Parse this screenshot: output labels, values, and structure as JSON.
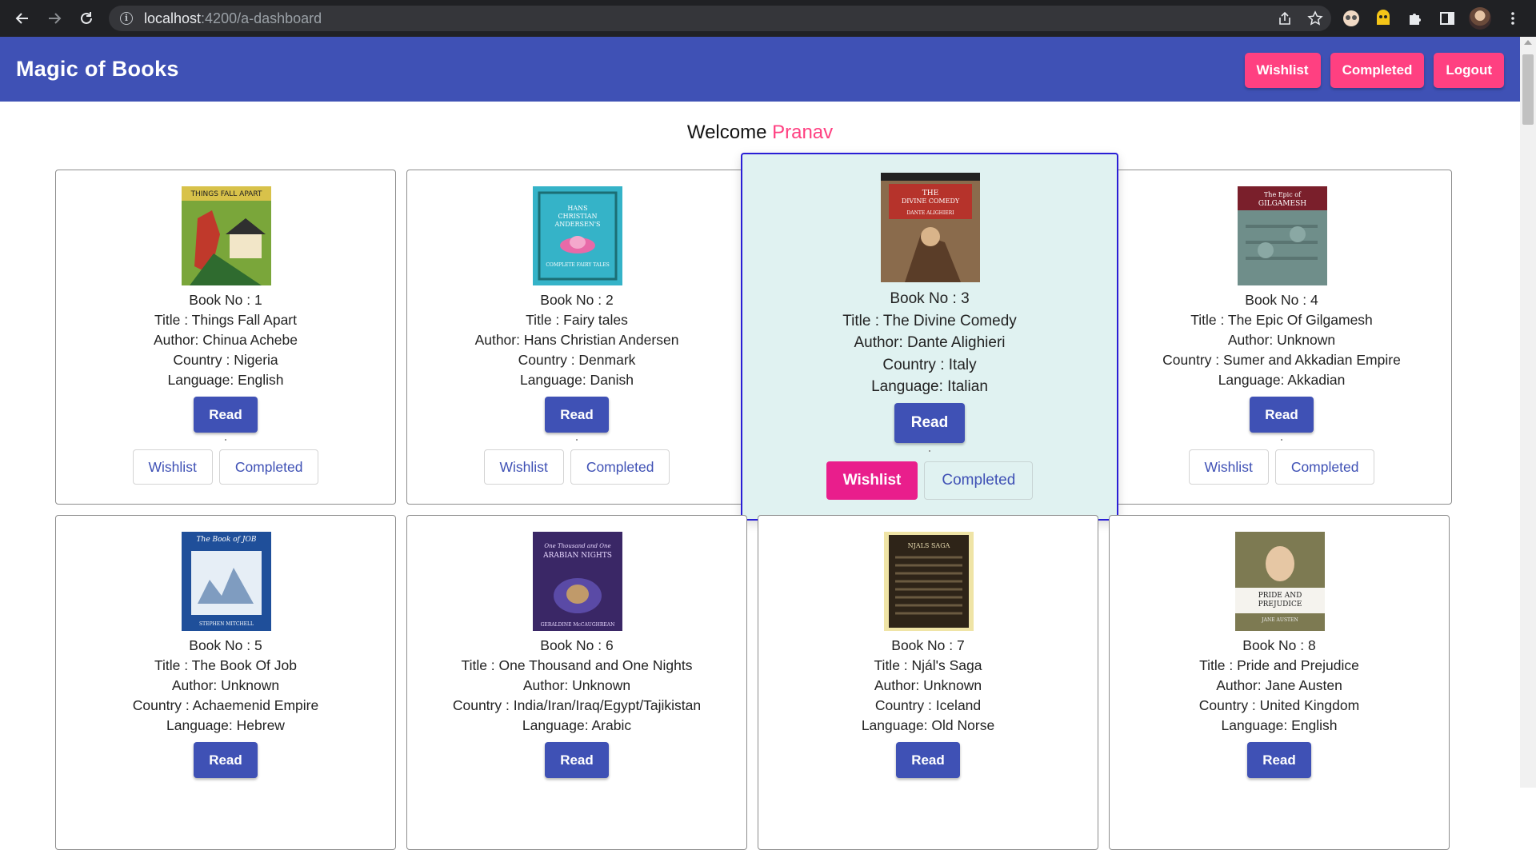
{
  "browser": {
    "url_host": "localhost",
    "url_path": ":4200/a-dashboard"
  },
  "toolbar": {
    "title": "Magic of Books",
    "wishlist_label": "Wishlist",
    "completed_label": "Completed",
    "logout_label": "Logout",
    "accent_color": "#3f51b5",
    "button_color": "#ff4081"
  },
  "welcome": {
    "prefix": "Welcome",
    "user": "Pranav"
  },
  "labels": {
    "read": "Read",
    "wishlist": "Wishlist",
    "completed": "Completed"
  },
  "books": [
    {
      "no": "Book No : 1",
      "title": "Title : Things Fall Apart",
      "author": "Author: Chinua Achebe",
      "country": "Country : Nigeria",
      "language": "Language: English",
      "cover_text": "THINGS FALL APART"
    },
    {
      "no": "Book No : 2",
      "title": "Title : Fairy tales",
      "author": "Author: Hans Christian Andersen",
      "country": "Country : Denmark",
      "language": "Language: Danish",
      "cover_text": "HANS CHRISTIAN ANDERSEN'S"
    },
    {
      "no": "Book No : 3",
      "title": "Title : The Divine Comedy",
      "author": "Author: Dante Alighieri",
      "country": "Country : Italy",
      "language": "Language: Italian",
      "cover_text": "THE DIVINE COMEDY"
    },
    {
      "no": "Book No : 4",
      "title": "Title : The Epic Of Gilgamesh",
      "author": "Author: Unknown",
      "country": "Country : Sumer and Akkadian Empire",
      "language": "Language: Akkadian",
      "cover_text": "The Epic of GILGAMESH"
    },
    {
      "no": "Book No : 5",
      "title": "Title : The Book Of Job",
      "author": "Author: Unknown",
      "country": "Country : Achaemenid Empire",
      "language": "Language: Hebrew",
      "cover_text": "The Book of JOB"
    },
    {
      "no": "Book No : 6",
      "title": "Title : One Thousand and One Nights",
      "author": "Author: Unknown",
      "country": "Country : India/Iran/Iraq/Egypt/Tajikistan",
      "language": "Language: Arabic",
      "cover_text": "ARABIAN NIGHTS"
    },
    {
      "no": "Book No : 7",
      "title": "Title : Njál's Saga",
      "author": "Author: Unknown",
      "country": "Country : Iceland",
      "language": "Language: Old Norse",
      "cover_text": "NJALS SAGA"
    },
    {
      "no": "Book No : 8",
      "title": "Title : Pride and Prejudice",
      "author": "Author: Jane Austen",
      "country": "Country : United Kingdom",
      "language": "Language: English",
      "cover_text": "PRIDE AND PREJUDICE"
    }
  ]
}
